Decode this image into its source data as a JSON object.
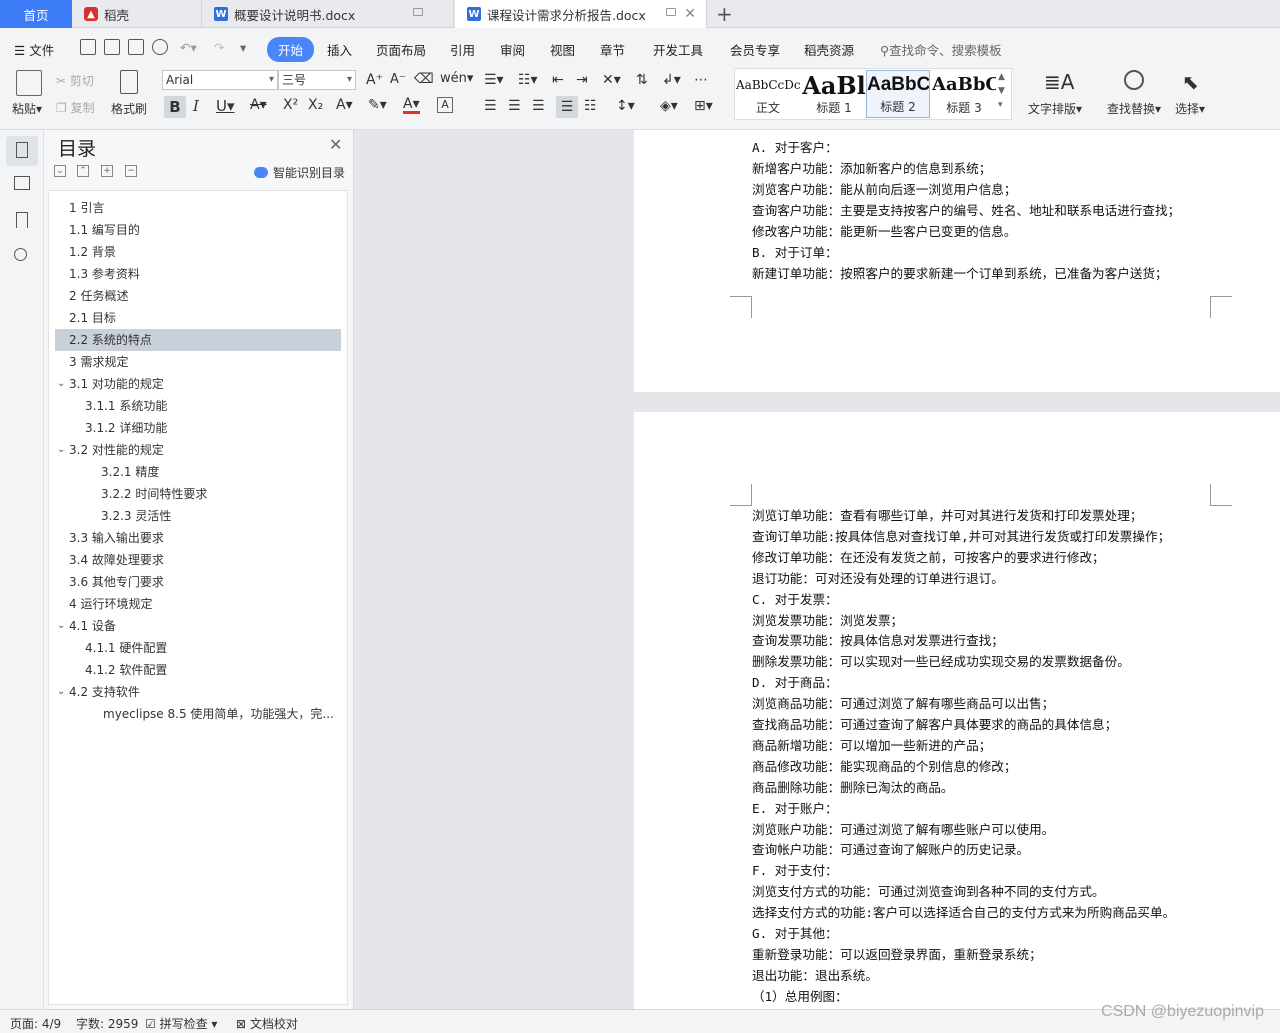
{
  "tabs": {
    "home": "首页",
    "wps": "稻壳",
    "doc1": "概要设计说明书.docx",
    "doc2": "课程设计需求分析报告.docx"
  },
  "menu": {
    "file": "文件",
    "items": [
      "开始",
      "插入",
      "页面布局",
      "引用",
      "审阅",
      "视图",
      "章节",
      "开发工具",
      "会员专享",
      "稻壳资源"
    ],
    "search_placeholder": "查找命令、搜索模板"
  },
  "ribbon": {
    "paste": "粘贴",
    "cut": "剪切",
    "copy": "复制",
    "format_painter": "格式刷",
    "font_name": "Arial",
    "font_size": "三号",
    "styles": [
      {
        "preview": "AaBbCcDc",
        "label": "正文"
      },
      {
        "preview": "AaBl",
        "label": "标题 1"
      },
      {
        "preview": "AaBbC",
        "label": "标题 2"
      },
      {
        "preview": "AaBbC",
        "label": "标题 3"
      }
    ],
    "text_layout": "文字排版",
    "find_replace": "查找替换",
    "select": "选择"
  },
  "toc": {
    "title": "目录",
    "smart_label": "智能识别目录",
    "items": [
      "1 引言",
      "1.1 编写目的",
      "1.2 背景",
      "1.3 参考资料",
      "2 任务概述",
      "2.1 目标",
      "2.2 系统的特点",
      "3 需求规定",
      "3.1 对功能的规定",
      "3.1.1 系统功能",
      "3.1.2 详细功能",
      "3.2 对性能的规定",
      "3.2.1 精度",
      "3.2.2 时间特性要求",
      "3.2.3 灵活性",
      "3.3 输入输出要求",
      "3.4 故障处理要求",
      "3.6 其他专门要求",
      "4 运行环境规定",
      "4.1 设备",
      "4.1.1 硬件配置",
      "4.1.2  软件配置",
      "4.2 支持软件",
      "myeclipse 8.5 使用简单，功能强大，完..."
    ]
  },
  "page1": {
    "lines": [
      "A. 对于客户：",
      "新增客户功能：添加新客户的信息到系统；",
      "浏览客户功能：能从前向后逐一浏览用户信息；",
      "查询客户功能：主要是支持按客户的编号、姓名、地址和联系电话进行查找；",
      "修改客户功能：能更新一些客户已变更的信息。",
      "B. 对于订单：",
      "新建订单功能：按照客户的要求新建一个订单到系统，已准备为客户送货；"
    ]
  },
  "page2": {
    "lines": [
      "浏览订单功能：查看有哪些订单，并可对其进行发货和打印发票处理；",
      "查询订单功能:按具体信息对查找订单,并可对其进行发货或打印发票操作；",
      "修改订单功能：在还没有发货之前，可按客户的要求进行修改；",
      "退订功能：可对还没有处理的订单进行退订。",
      "C. 对于发票：",
      "浏览发票功能：浏览发票；",
      "查询发票功能：按具体信息对发票进行查找；",
      "删除发票功能：可以实现对一些已经成功实现交易的发票数据备份。",
      "D. 对于商品：",
      "浏览商品功能：可通过浏览了解有哪些商品可以出售；",
      "查找商品功能：可通过查询了解客户具体要求的商品的具体信息；",
      "商品新增功能：可以增加一些新进的产品；",
      "商品修改功能：能实现商品的个别信息的修改；",
      "商品删除功能：删除已淘汰的商品。",
      "E. 对于账户：",
      "浏览账户功能：可通过浏览了解有哪些账户可以使用。",
      "查询帐户功能：可通过查询了解账户的历史记录。",
      "F. 对于支付：",
      "浏览支付方式的功能：可通过浏览查询到各种不同的支付方式。",
      "选择支付方式的功能:客户可以选择适合自己的支付方式来为所购商品买单。",
      "G. 对于其他：",
      "    重新登录功能：可以返回登录界面，重新登录系统；",
      "退出功能：退出系统。",
      "（1）总用例图："
    ]
  },
  "status": {
    "page": "页面: 4/9",
    "words": "字数: 2959",
    "spell": "拼写检查",
    "proof": "文档校对"
  },
  "watermark": "CSDN @biyezuopinvip"
}
